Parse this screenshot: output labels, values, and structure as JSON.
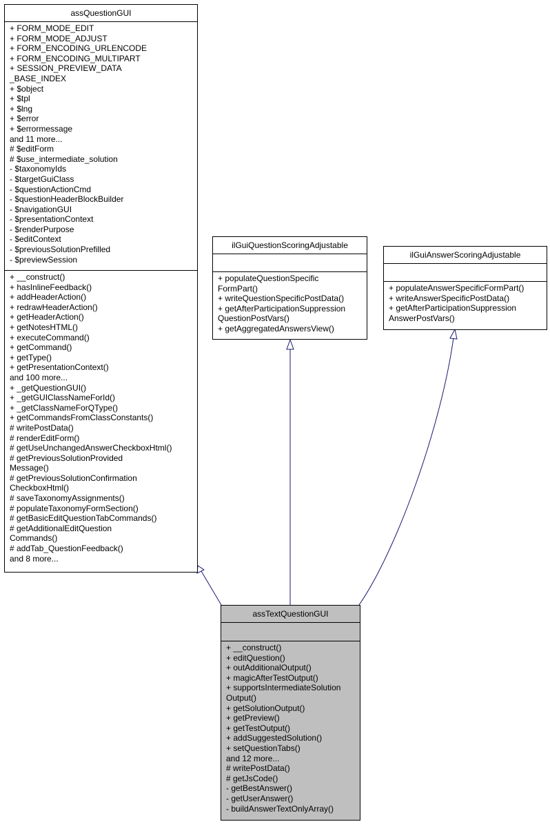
{
  "diagram": {
    "type": "uml-class-inheritance",
    "classes": {
      "assQuestionGUI": {
        "name": "assQuestionGUI",
        "attributes": [
          "+ FORM_MODE_EDIT",
          "+ FORM_MODE_ADJUST",
          "+ FORM_ENCODING_URLENCODE",
          "+ FORM_ENCODING_MULTIPART",
          "+ SESSION_PREVIEW_DATA",
          "_BASE_INDEX",
          "+ $object",
          "+ $tpl",
          "+ $lng",
          "+ $error",
          "+ $errormessage",
          "and 11 more...",
          "# $editForm",
          "# $use_intermediate_solution",
          "- $taxonomyIds",
          "- $targetGuiClass",
          "- $questionActionCmd",
          "- $questionHeaderBlockBuilder",
          "- $navigationGUI",
          "- $presentationContext",
          "- $renderPurpose",
          "- $editContext",
          "- $previousSolutionPrefilled",
          "- $previewSession"
        ],
        "methods": [
          "+ __construct()",
          "+ hasInlineFeedback()",
          "+ addHeaderAction()",
          "+ redrawHeaderAction()",
          "+ getHeaderAction()",
          "+ getNotesHTML()",
          "+ executeCommand()",
          "+ getCommand()",
          "+ getType()",
          "+ getPresentationContext()",
          "and 100 more...",
          "+ _getQuestionGUI()",
          "+ _getGUIClassNameForId()",
          "+ _getClassNameForQType()",
          "+ getCommandsFromClassConstants()",
          "# writePostData()",
          "# renderEditForm()",
          "# getUseUnchangedAnswerCheckboxHtml()",
          "# getPreviousSolutionProvided",
          "Message()",
          "# getPreviousSolutionConfirmation",
          "CheckboxHtml()",
          "# saveTaxonomyAssignments()",
          "# populateTaxonomyFormSection()",
          "# getBasicEditQuestionTabCommands()",
          "# getAdditionalEditQuestion",
          "Commands()",
          "# addTab_QuestionFeedback()",
          "and 8 more..."
        ]
      },
      "ilGuiQuestionScoringAdjustable": {
        "name": "ilGuiQuestionScoringAdjustable",
        "attributes": [],
        "methods": [
          "+ populateQuestionSpecific",
          "FormPart()",
          "+ writeQuestionSpecificPostData()",
          "+ getAfterParticipationSuppression",
          "QuestionPostVars()",
          "+ getAggregatedAnswersView()"
        ]
      },
      "ilGuiAnswerScoringAdjustable": {
        "name": "ilGuiAnswerScoringAdjustable",
        "attributes": [],
        "methods": [
          "+ populateAnswerSpecificFormPart()",
          "+ writeAnswerSpecificPostData()",
          "+ getAfterParticipationSuppression",
          "AnswerPostVars()"
        ]
      },
      "assTextQuestionGUI": {
        "name": "assTextQuestionGUI",
        "attributes": [],
        "methods": [
          "+ __construct()",
          "+ editQuestion()",
          "+ outAdditionalOutput()",
          "+ magicAfterTestOutput()",
          "+ supportsIntermediateSolution",
          "Output()",
          "+ getSolutionOutput()",
          "+ getPreview()",
          "+ getTestOutput()",
          "+ addSuggestedSolution()",
          "+ setQuestionTabs()",
          "and 12 more...",
          "# writePostData()",
          "# getJsCode()",
          "- getBestAnswer()",
          "- getUserAnswer()",
          "- buildAnswerTextOnlyArray()"
        ]
      }
    },
    "edges": [
      {
        "from": "assTextQuestionGUI",
        "to": "assQuestionGUI",
        "kind": "inheritance"
      },
      {
        "from": "assTextQuestionGUI",
        "to": "ilGuiQuestionScoringAdjustable",
        "kind": "inheritance"
      },
      {
        "from": "assTextQuestionGUI",
        "to": "ilGuiAnswerScoringAdjustable",
        "kind": "inheritance"
      }
    ],
    "colors": {
      "edge": "#191970",
      "focus_fill": "#bfbfbf",
      "box_border": "#000000"
    }
  }
}
